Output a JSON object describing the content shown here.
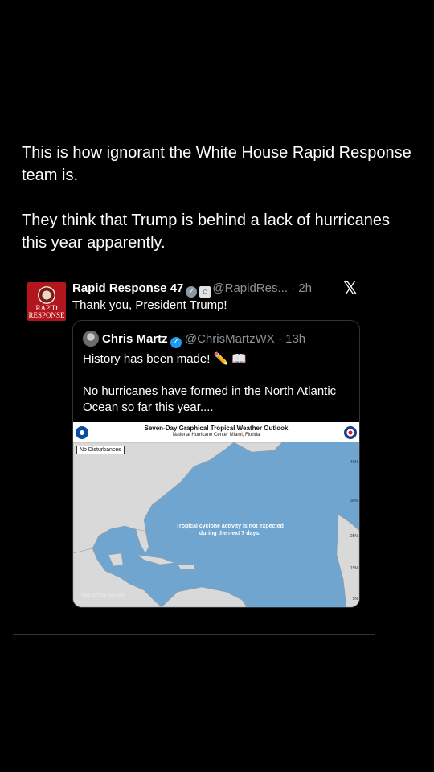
{
  "caption": {
    "line1": "This is how ignorant the White House Rapid Response team is.",
    "line2": "They think that Trump is behind a lack of hurricanes this year apparently."
  },
  "tweet": {
    "avatar_text_top": "RAPID",
    "avatar_text_bottom": "RESPONSE",
    "name": "Rapid Response 47",
    "handle": "@RapidRes...",
    "time": "· 2h",
    "text": "Thank you, President Trump!",
    "x_logo": "𝕏",
    "icons": {
      "verified": "gray-check-badge-icon",
      "gov": "white-house-icon"
    }
  },
  "quote": {
    "name": "Chris Martz",
    "handle": "@ChrisMartzWX",
    "time": "· 13h",
    "line1": "History has been made! ✏️ 📖",
    "line2": "No hurricanes have formed in the North Atlantic Ocean so far this year...."
  },
  "map": {
    "title": "Seven-Day Graphical Tropical Weather Outlook",
    "subtitle": "National Hurricane Center  Miami, Florida",
    "disturbances_label": "No Disturbances",
    "outlook_text": "Tropical cyclone activity is not expected during the next 7 days.",
    "lat_labels": [
      "40N",
      "30N",
      "25N",
      "15N",
      "5N"
    ],
    "stamp": "8 AM EDT Sat Sep 2025",
    "colors": {
      "ocean": "#6fa5cf",
      "land": "#d9d9d9"
    }
  }
}
